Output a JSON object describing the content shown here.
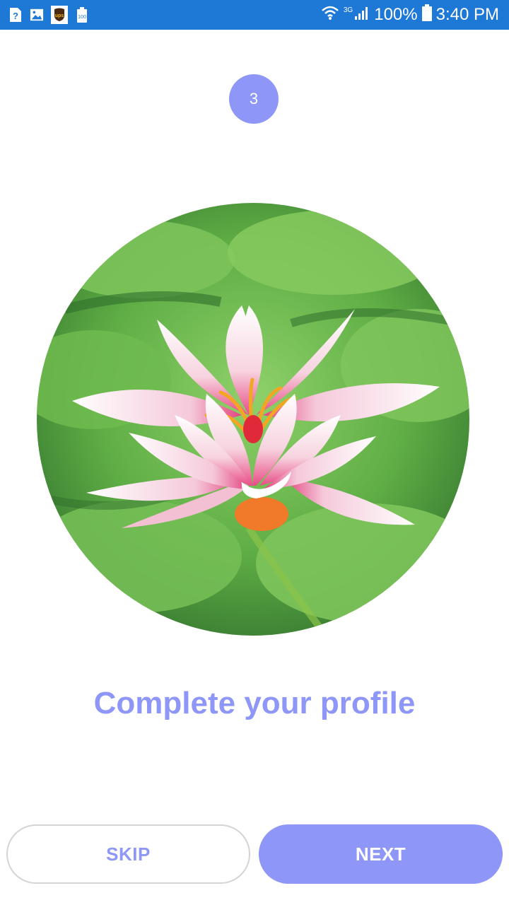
{
  "status_bar": {
    "icons_left": [
      "help-icon",
      "image-icon",
      "ups-icon",
      "battery-saver-icon"
    ],
    "ups_label": "ups",
    "battery_saver_label": "100",
    "network": "3G",
    "battery_percent": "100%",
    "time": "3:40 PM",
    "color": "#1e78d6"
  },
  "onboarding": {
    "step": "3",
    "image": "pink-lotus-flower-on-lily-pads",
    "title": "Complete your profile",
    "accent_color": "#8e96f7"
  },
  "actions": {
    "skip_label": "SKIP",
    "next_label": "NEXT"
  }
}
